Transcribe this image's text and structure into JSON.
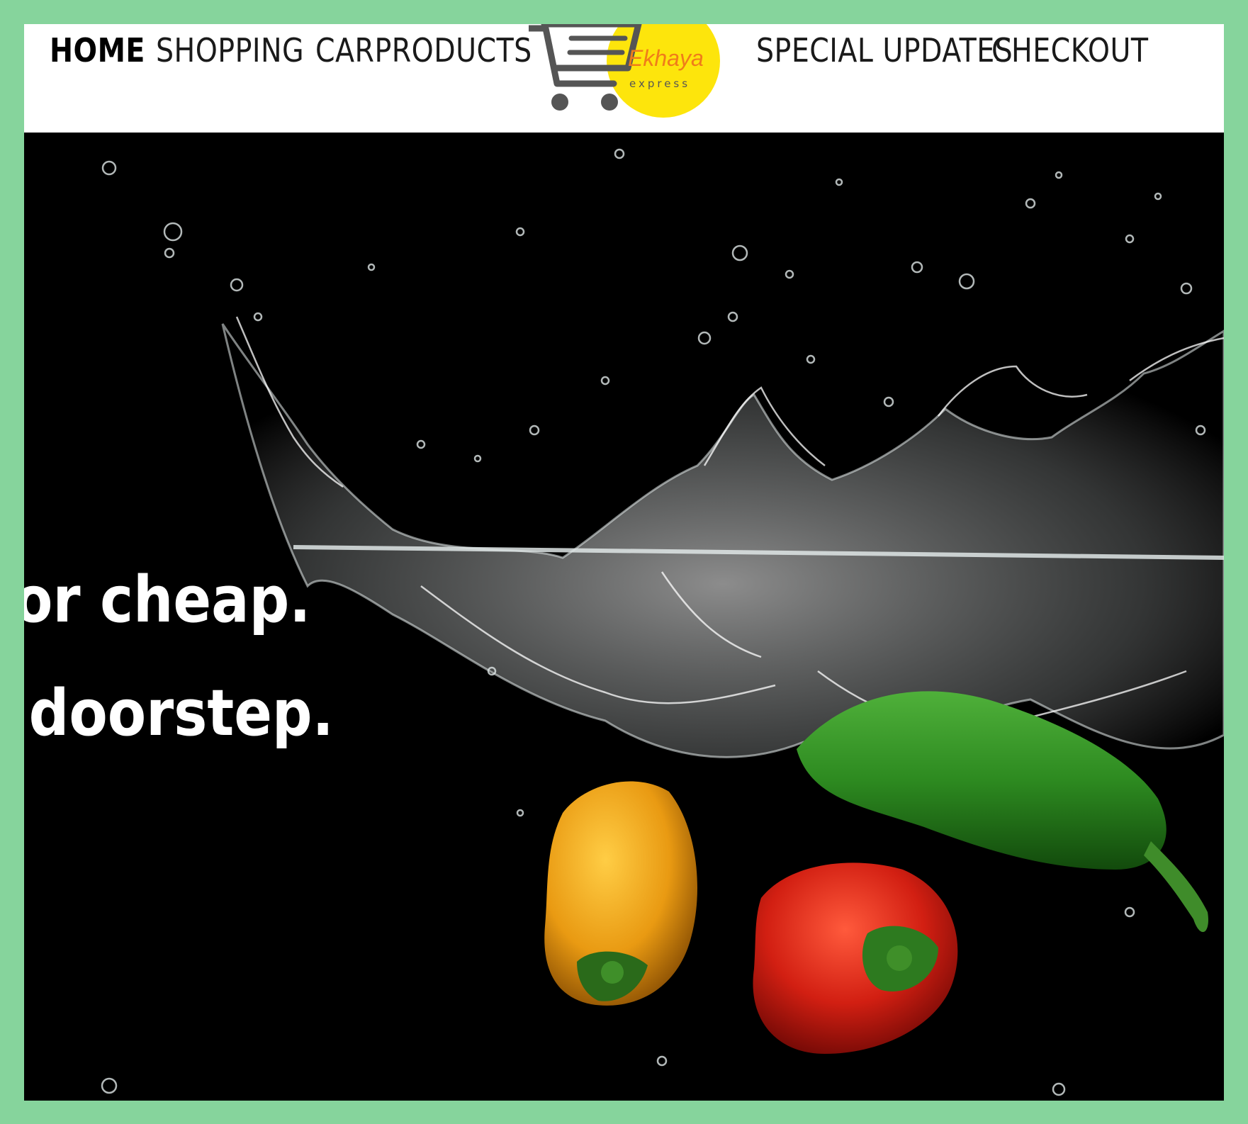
{
  "nav": {
    "items": [
      {
        "label": "HOME",
        "active": true
      },
      {
        "label": "SHOPPING",
        "active": false
      },
      {
        "label": "CARPRODUCTS",
        "active": false
      },
      {
        "label": "SPECIAL UPDATES",
        "active": false
      },
      {
        "label": "CHECKOUT",
        "active": false
      }
    ]
  },
  "logo": {
    "name": "Ekhaya",
    "tagline": "express",
    "icon": "shopping-cart-icon",
    "colors": {
      "circle": "#fde50c",
      "name": "#f07c1a",
      "cart": "#555555"
    }
  },
  "hero": {
    "lines": [
      "or cheap.",
      "doorstep."
    ],
    "image": "vegetables-splashing-in-water",
    "background": "#000000"
  }
}
